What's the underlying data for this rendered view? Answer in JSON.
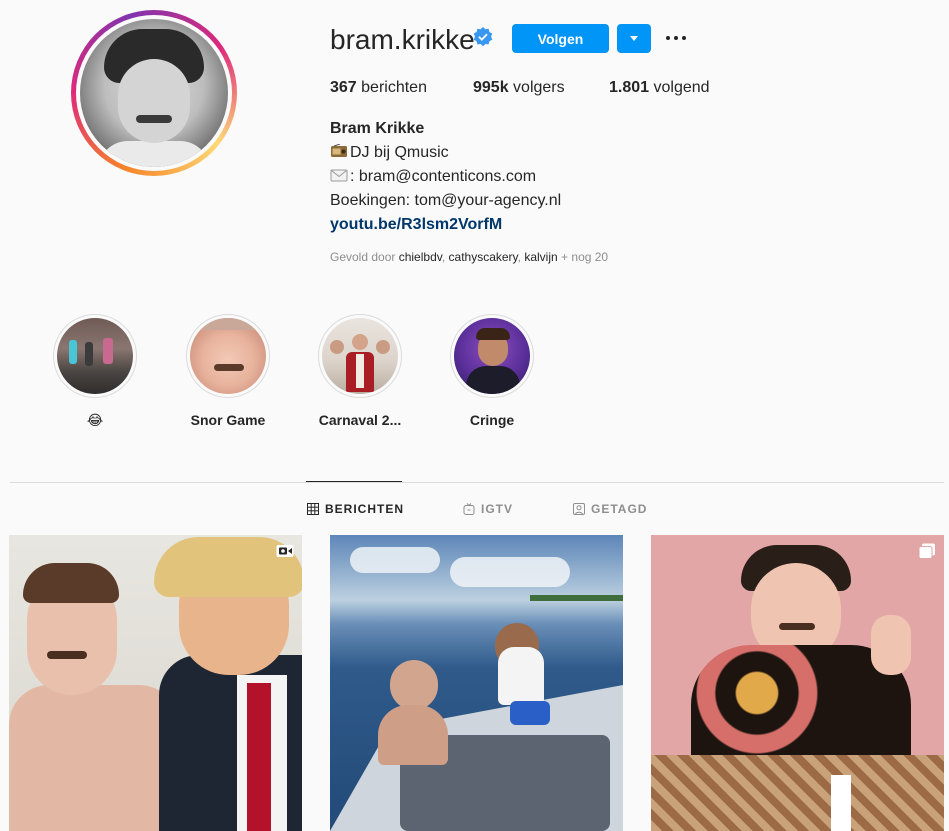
{
  "profile": {
    "username": "bram.krikke",
    "follow_label": "Volgen",
    "stats": {
      "posts": {
        "value": "367",
        "label": "berichten"
      },
      "followers": {
        "value": "995k",
        "label": "volgers"
      },
      "following": {
        "value": "1.801",
        "label": "volgend"
      }
    },
    "full_name": "Bram Krikke",
    "bio": [
      "DJ bij Qmusic",
      ": bram@contenticons.com",
      "Boekingen: tom@your-agency.nl"
    ],
    "link": "youtu.be/R3lsm2VorfM",
    "followed_by": {
      "prefix": "Gevold door",
      "users": [
        "chielbdv",
        "cathyscakery",
        "kalvijn"
      ],
      "more": "+ nog 20"
    }
  },
  "highlights": [
    {
      "label": "😂"
    },
    {
      "label": "Snor Game"
    },
    {
      "label": "Carnaval 2..."
    },
    {
      "label": "Cringe"
    }
  ],
  "tabs": [
    {
      "label": "BERICHTEN",
      "active": true
    },
    {
      "label": "IGTV",
      "active": false
    },
    {
      "label": "GETAGD",
      "active": false
    }
  ],
  "colors": {
    "accent": "#0095f6",
    "link": "#00376b",
    "muted": "#8e8e8e"
  },
  "icons": [
    "verified-badge-icon",
    "chevron-down-icon",
    "more-options-icon",
    "grid-icon",
    "igtv-icon",
    "tagged-icon",
    "video-icon",
    "carousel-icon",
    "radio-icon",
    "envelope-icon"
  ]
}
